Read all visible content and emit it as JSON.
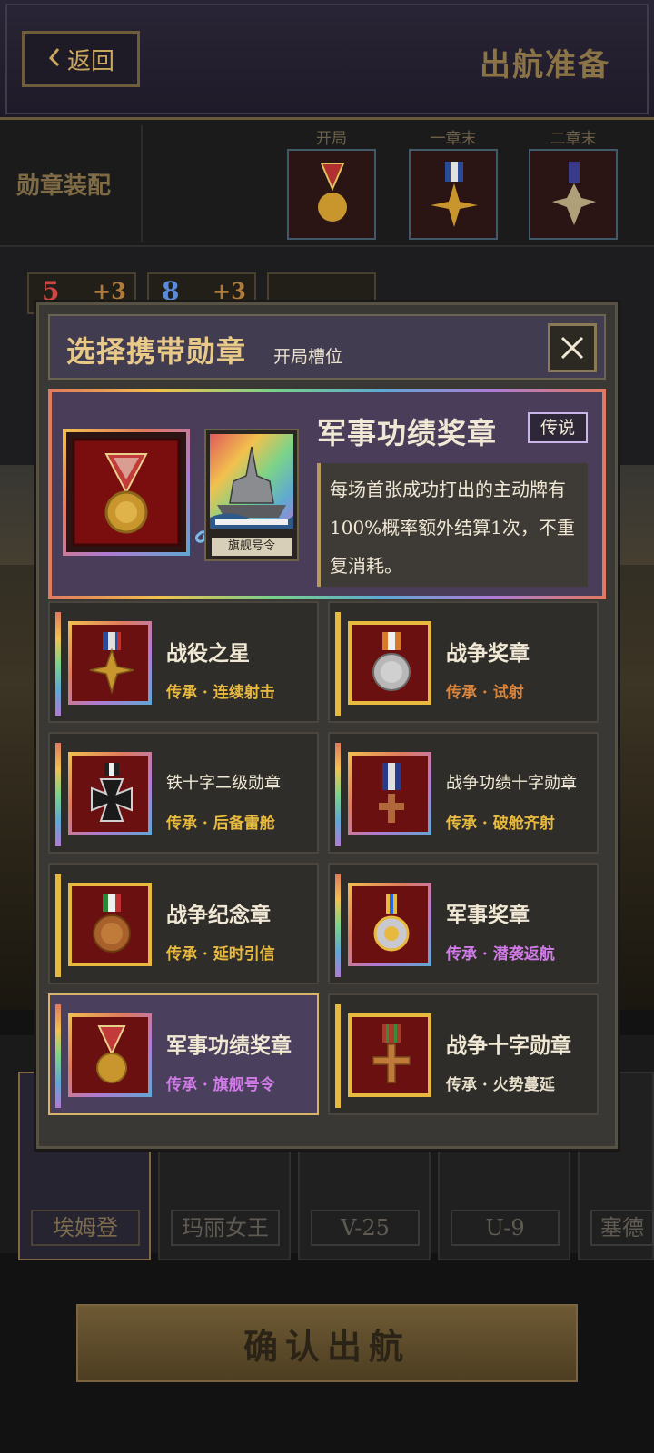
{
  "header": {
    "back_label": "返回",
    "title": "出航准备"
  },
  "medal_setup": {
    "title": "勋章装配",
    "slots": [
      {
        "label": "开局"
      },
      {
        "label": "一章末"
      },
      {
        "label": "二章末"
      }
    ]
  },
  "badges": [
    "5",
    "+3",
    "8",
    "+3"
  ],
  "ships": [
    "埃姆登",
    "玛丽女王",
    "V-25",
    "U-9",
    "塞德"
  ],
  "confirm_label": "确认出航",
  "dialog": {
    "title": "选择携带勋章",
    "subtitle": "开局槽位",
    "featured": {
      "name": "军事功绩奖章",
      "rarity": "传说",
      "card_label": "旗舰号令",
      "description": "每场首张成功打出的主动牌有100%概率额外结算1次，不重复消耗。"
    },
    "medals": [
      {
        "name": "战役之星",
        "sub": "传承 · 连续射击",
        "sub_color": "#e7b93f"
      },
      {
        "name": "战争奖章",
        "sub": "传承 · 试射",
        "sub_color": "#d9843c"
      },
      {
        "name": "铁十字二级勋章",
        "sub": "传承 · 后备雷舱",
        "sub_color": "#e7b93f"
      },
      {
        "name": "战争功绩十字勋章",
        "sub": "传承 · 破舱齐射",
        "sub_color": "#e7b93f"
      },
      {
        "name": "战争纪念章",
        "sub": "传承 · 延时引信",
        "sub_color": "#e7b93f"
      },
      {
        "name": "军事奖章",
        "sub": "传承 · 潜袭返航",
        "sub_color": "#d17be8"
      },
      {
        "name": "军事功绩奖章",
        "sub": "传承 · 旗舰号令",
        "sub_color": "#d17be8"
      },
      {
        "name": "战争十字勋章",
        "sub": "传承 · 火势蔓延",
        "sub_color": "#e8e0cc"
      }
    ]
  },
  "colors": {
    "accent_gold": "#e7b93f",
    "legend_purple": "#d17be8",
    "panel": "#3a3834"
  },
  "icons": [
    "chevron-left-icon",
    "close-icon",
    "link-icon",
    "medal-icon",
    "battleship-icon"
  ]
}
